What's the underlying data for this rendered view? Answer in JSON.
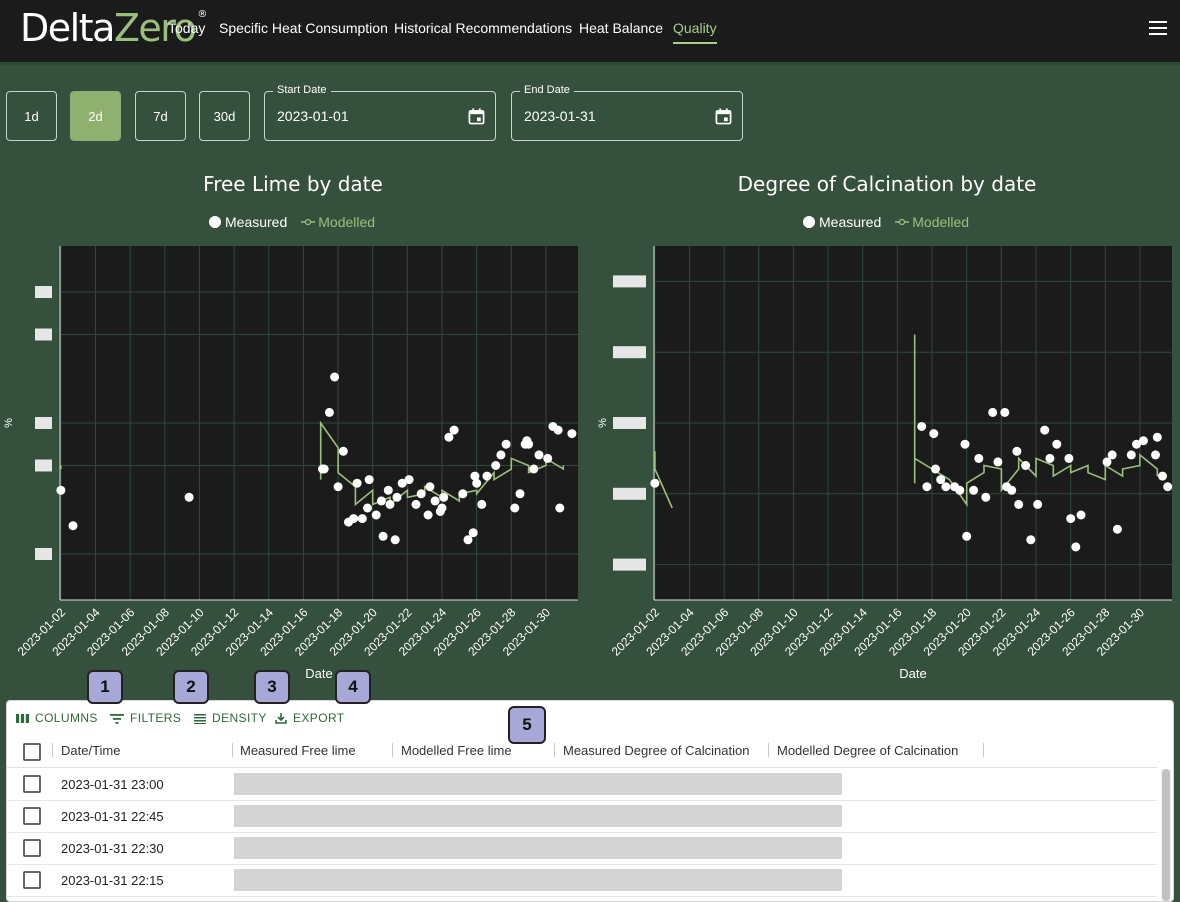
{
  "app": {
    "logo_part1": "Delta",
    "logo_part2": "Zero",
    "logo_reg": "®"
  },
  "nav": [
    "Today",
    "Specific Heat Consumption",
    "Historical Recommendations",
    "Heat Balance",
    "Quality"
  ],
  "nav_active": "Quality",
  "ranges": [
    "1d",
    "2d",
    "7d",
    "30d"
  ],
  "range_active": "2d",
  "start_date": {
    "label": "Start Date",
    "value": "2023-01-01"
  },
  "end_date": {
    "label": "End Date",
    "value": "2023-01-31"
  },
  "colors": {
    "accent": "#8fb06e",
    "background": "#36503e",
    "plot_bg": "#1b1b1b",
    "modelled_line": "#9bc07a",
    "measured_point": "#ffffff"
  },
  "chart_data": [
    {
      "type": "scatter",
      "title": "Free Lime by date",
      "xlabel": "Date",
      "ylabel": "%",
      "legend": [
        "Measured",
        "Modelled"
      ],
      "legend_position": "top",
      "grid": true,
      "x_ticks": [
        "2023-01-02",
        "2023-01-04",
        "2023-01-06",
        "2023-01-08",
        "2023-01-10",
        "2023-01-12",
        "2023-01-14",
        "2023-01-16",
        "2023-01-18",
        "2023-01-20",
        "2023-01-22",
        "2023-01-24",
        "2023-01-26",
        "2023-01-28",
        "2023-01-30"
      ],
      "x_range": [
        "2023-01-02",
        "2023-01-31"
      ],
      "y_range": [
        0,
        1
      ],
      "y_ticks_redacted": 5,
      "series": [
        {
          "name": "Measured",
          "points": [
            [
              "2023-01-02",
              0.31
            ],
            [
              "2023-01-02",
              0.21
            ],
            [
              "2023-01-09",
              0.29
            ],
            [
              "2023-01-17",
              0.37
            ],
            [
              "2023-01-17",
              0.63
            ],
            [
              "2023-01-17",
              0.53
            ],
            [
              "2023-01-17",
              0.37
            ],
            [
              "2023-01-18",
              0.23
            ],
            [
              "2023-01-18",
              0.22
            ],
            [
              "2023-01-18",
              0.42
            ],
            [
              "2023-01-18",
              0.32
            ],
            [
              "2023-01-19",
              0.26
            ],
            [
              "2023-01-19",
              0.23
            ],
            [
              "2023-01-19",
              0.33
            ],
            [
              "2023-01-19",
              0.34
            ],
            [
              "2023-01-20",
              0.28
            ],
            [
              "2023-01-20",
              0.24
            ],
            [
              "2023-01-20",
              0.31
            ],
            [
              "2023-01-20",
              0.18
            ],
            [
              "2023-01-21",
              0.17
            ],
            [
              "2023-01-21",
              0.27
            ],
            [
              "2023-01-21",
              0.33
            ],
            [
              "2023-01-21",
              0.29
            ],
            [
              "2023-01-22",
              0.34
            ],
            [
              "2023-01-22",
              0.3
            ],
            [
              "2023-01-22",
              0.27
            ],
            [
              "2023-01-23",
              0.24
            ],
            [
              "2023-01-23",
              0.25
            ],
            [
              "2023-01-23",
              0.28
            ],
            [
              "2023-01-23",
              0.32
            ],
            [
              "2023-01-24",
              0.26
            ],
            [
              "2023-01-24",
              0.48
            ],
            [
              "2023-01-24",
              0.46
            ],
            [
              "2023-01-24",
              0.29
            ],
            [
              "2023-01-25",
              0.19
            ],
            [
              "2023-01-25",
              0.17
            ],
            [
              "2023-01-25",
              0.3
            ],
            [
              "2023-01-25",
              0.35
            ],
            [
              "2023-01-26",
              0.35
            ],
            [
              "2023-01-26",
              0.27
            ],
            [
              "2023-01-26",
              0.33
            ],
            [
              "2023-01-27",
              0.44
            ],
            [
              "2023-01-27",
              0.41
            ],
            [
              "2023-01-27",
              0.38
            ],
            [
              "2023-01-28",
              0.44
            ],
            [
              "2023-01-28",
              0.3
            ],
            [
              "2023-01-28",
              0.26
            ],
            [
              "2023-01-28",
              0.45
            ],
            [
              "2023-01-29",
              0.41
            ],
            [
              "2023-01-29",
              0.37
            ],
            [
              "2023-01-29",
              0.44
            ],
            [
              "2023-01-30",
              0.48
            ],
            [
              "2023-01-30",
              0.49
            ],
            [
              "2023-01-30",
              0.4
            ],
            [
              "2023-01-30",
              0.26
            ],
            [
              "2023-01-31",
              0.47
            ]
          ]
        },
        {
          "name": "Modelled",
          "segments": [
            [
              [
                "2023-01-02",
                0.38
              ],
              [
                "2023-01-02",
                0.37
              ]
            ],
            [
              [
                "2023-01-17",
                0.34
              ],
              [
                "2023-01-17",
                0.39
              ],
              [
                "2023-01-17",
                0.5
              ],
              [
                "2023-01-18",
                0.43
              ],
              [
                "2023-01-18",
                0.36
              ],
              [
                "2023-01-19",
                0.32
              ],
              [
                "2023-01-19",
                0.27
              ],
              [
                "2023-01-20",
                0.31
              ],
              [
                "2023-01-20",
                0.27
              ],
              [
                "2023-01-21",
                0.29
              ],
              [
                "2023-01-21",
                0.27
              ],
              [
                "2023-01-22",
                0.31
              ],
              [
                "2023-01-22",
                0.29
              ],
              [
                "2023-01-23",
                0.3
              ],
              [
                "2023-01-23",
                0.32
              ],
              [
                "2023-01-24",
                0.29
              ],
              [
                "2023-01-24",
                0.31
              ],
              [
                "2023-01-25",
                0.28
              ],
              [
                "2023-01-25",
                0.3
              ],
              [
                "2023-01-26",
                0.31
              ],
              [
                "2023-01-26",
                0.3
              ],
              [
                "2023-01-27",
                0.36
              ],
              [
                "2023-01-27",
                0.34
              ],
              [
                "2023-01-28",
                0.37
              ],
              [
                "2023-01-28",
                0.4
              ],
              [
                "2023-01-29",
                0.38
              ],
              [
                "2023-01-29",
                0.36
              ],
              [
                "2023-01-30",
                0.38
              ],
              [
                "2023-01-30",
                0.4
              ],
              [
                "2023-01-31",
                0.37
              ],
              [
                "2023-01-31",
                0.38
              ]
            ]
          ]
        }
      ]
    },
    {
      "type": "scatter",
      "title": "Degree of Calcination by date",
      "xlabel": "Date",
      "ylabel": "%",
      "legend": [
        "Measured",
        "Modelled"
      ],
      "legend_position": "top",
      "grid": true,
      "x_ticks": [
        "2023-01-02",
        "2023-01-04",
        "2023-01-06",
        "2023-01-08",
        "2023-01-10",
        "2023-01-12",
        "2023-01-14",
        "2023-01-16",
        "2023-01-18",
        "2023-01-20",
        "2023-01-22",
        "2023-01-24",
        "2023-01-26",
        "2023-01-28",
        "2023-01-30"
      ],
      "x_range": [
        "2023-01-02",
        "2023-01-31"
      ],
      "y_range": [
        0,
        1
      ],
      "y_ticks_redacted": 5,
      "series": [
        {
          "name": "Measured",
          "points": [
            [
              "2023-01-02",
              0.33
            ],
            [
              "2023-01-17",
              0.32
            ],
            [
              "2023-01-17",
              0.49
            ],
            [
              "2023-01-18",
              0.47
            ],
            [
              "2023-01-18",
              0.32
            ],
            [
              "2023-01-18",
              0.34
            ],
            [
              "2023-01-18",
              0.37
            ],
            [
              "2023-01-19",
              0.44
            ],
            [
              "2023-01-19",
              0.31
            ],
            [
              "2023-01-19",
              0.32
            ],
            [
              "2023-01-20",
              0.18
            ],
            [
              "2023-01-20",
              0.4
            ],
            [
              "2023-01-20",
              0.31
            ],
            [
              "2023-01-21",
              0.29
            ],
            [
              "2023-01-21",
              0.39
            ],
            [
              "2023-01-21",
              0.53
            ],
            [
              "2023-01-22",
              0.53
            ],
            [
              "2023-01-22",
              0.42
            ],
            [
              "2023-01-22",
              0.31
            ],
            [
              "2023-01-22",
              0.32
            ],
            [
              "2023-01-23",
              0.27
            ],
            [
              "2023-01-23",
              0.17
            ],
            [
              "2023-01-23",
              0.38
            ],
            [
              "2023-01-24",
              0.27
            ],
            [
              "2023-01-24",
              0.4
            ],
            [
              "2023-01-24",
              0.48
            ],
            [
              "2023-01-25",
              0.44
            ],
            [
              "2023-01-25",
              0.4
            ],
            [
              "2023-01-26",
              0.24
            ],
            [
              "2023-01-26",
              0.15
            ],
            [
              "2023-01-26",
              0.23
            ],
            [
              "2023-01-28",
              0.2
            ],
            [
              "2023-01-28",
              0.41
            ],
            [
              "2023-01-28",
              0.39
            ],
            [
              "2023-01-29",
              0.44
            ],
            [
              "2023-01-29",
              0.41
            ],
            [
              "2023-01-30",
              0.45
            ],
            [
              "2023-01-30",
              0.41
            ],
            [
              "2023-01-31",
              0.32
            ],
            [
              "2023-01-31",
              0.35
            ],
            [
              "2023-01-31",
              0.46
            ]
          ]
        },
        {
          "name": "Modelled",
          "segments": [
            [
              [
                "2023-01-02",
                0.41
              ],
              [
                "2023-01-02",
                0.42
              ],
              [
                "2023-01-02",
                0.37
              ],
              [
                "2023-01-03",
                0.26
              ],
              [
                "2023-01-03",
                0.26
              ]
            ],
            [
              [
                "2023-01-17",
                0.33
              ],
              [
                "2023-01-17",
                0.36
              ],
              [
                "2023-01-17",
                0.75
              ],
              [
                "2023-01-17",
                0.4
              ],
              [
                "2023-01-18",
                0.37
              ],
              [
                "2023-01-19",
                0.34
              ],
              [
                "2023-01-20",
                0.27
              ],
              [
                "2023-01-20",
                0.33
              ],
              [
                "2023-01-21",
                0.36
              ],
              [
                "2023-01-21",
                0.38
              ],
              [
                "2023-01-22",
                0.37
              ],
              [
                "2023-01-22",
                0.31
              ],
              [
                "2023-01-23",
                0.37
              ],
              [
                "2023-01-23",
                0.4
              ],
              [
                "2023-01-24",
                0.35
              ],
              [
                "2023-01-24",
                0.4
              ],
              [
                "2023-01-25",
                0.38
              ],
              [
                "2023-01-25",
                0.35
              ],
              [
                "2023-01-26",
                0.38
              ],
              [
                "2023-01-26",
                0.36
              ],
              [
                "2023-01-27",
                0.38
              ],
              [
                "2023-01-27",
                0.36
              ],
              [
                "2023-01-28",
                0.34
              ],
              [
                "2023-01-28",
                0.38
              ],
              [
                "2023-01-29",
                0.35
              ],
              [
                "2023-01-29",
                0.37
              ],
              [
                "2023-01-30",
                0.38
              ],
              [
                "2023-01-30",
                0.41
              ],
              [
                "2023-01-31",
                0.37
              ],
              [
                "2023-01-31",
                0.35
              ]
            ]
          ]
        }
      ]
    }
  ],
  "grid_toolbar": {
    "columns": "COLUMNS",
    "filters": "FILTERS",
    "density": "DENSITY",
    "export": "EXPORT"
  },
  "table": {
    "columns": [
      "Date/Time",
      "Measured Free lime",
      "Modelled Free lime",
      "Measured Degree of Calcination",
      "Modelled Degree of Calcination"
    ],
    "rows": [
      {
        "datetime": "2023-01-31 23:00"
      },
      {
        "datetime": "2023-01-31 22:45"
      },
      {
        "datetime": "2023-01-31 22:30"
      },
      {
        "datetime": "2023-01-31 22:15"
      }
    ]
  },
  "badges": [
    "1",
    "2",
    "3",
    "4",
    "5"
  ]
}
